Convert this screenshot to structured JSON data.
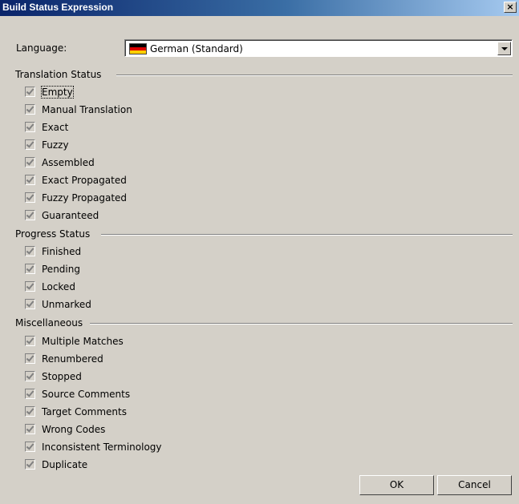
{
  "window": {
    "title": "Build Status Expression",
    "close_glyph": "×"
  },
  "language": {
    "label": "Language:",
    "value": "German (Standard)",
    "flag_icon": "germany-flag-icon"
  },
  "sections": {
    "translation": {
      "label": "Translation Status",
      "items": [
        "Empty",
        "Manual Translation",
        "Exact",
        "Fuzzy",
        "Assembled",
        "Exact Propagated",
        "Fuzzy Propagated",
        "Guaranteed"
      ]
    },
    "progress": {
      "label": "Progress Status",
      "items": [
        "Finished",
        "Pending",
        "Locked",
        "Unmarked"
      ]
    },
    "misc": {
      "label": "Miscellaneous",
      "items": [
        "Multiple Matches",
        "Renumbered",
        "Stopped",
        "Source Comments",
        "Target Comments",
        "Wrong Codes",
        "Inconsistent Terminology",
        "Duplicate"
      ]
    }
  },
  "checked": true,
  "buttons": {
    "ok": "OK",
    "cancel": "Cancel"
  },
  "colors": {
    "titlebar_start": "#0a246a",
    "titlebar_end": "#a6caf0",
    "dialog_bg": "#d4d0c8"
  }
}
